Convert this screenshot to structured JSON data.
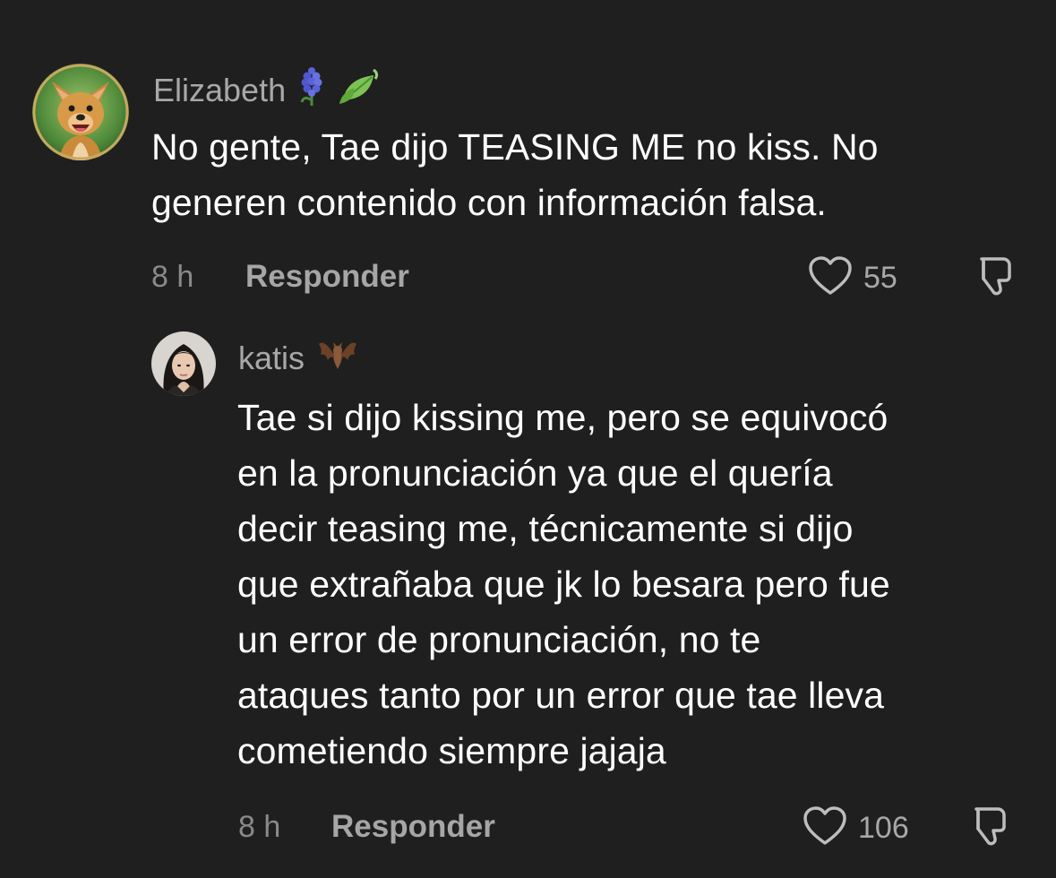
{
  "comments": [
    {
      "user": {
        "name": "Elizabeth",
        "badges": [
          "hyacinth-icon",
          "leaf-icon"
        ]
      },
      "text_lines": [
        "No gente, Tae dijo TEASING ME no kiss. No",
        "generen contenido con información falsa."
      ],
      "time": "8 h",
      "reply_label": "Responder",
      "likes": "55"
    },
    {
      "user": {
        "name": "katis",
        "badges": [
          "bat-icon"
        ]
      },
      "text_lines": [
        "Tae si dijo kissing me, pero se equivocó",
        "en la pronunciación ya que el quería",
        "decir teasing me, técnicamente si dijo",
        "que extrañaba que jk lo besara pero fue",
        "un error de pronunciación, no te",
        "ataques tanto por un error que tae lleva",
        "cometiendo siempre jajaja"
      ],
      "time": "8 h",
      "reply_label": "Responder",
      "likes": "106"
    }
  ]
}
